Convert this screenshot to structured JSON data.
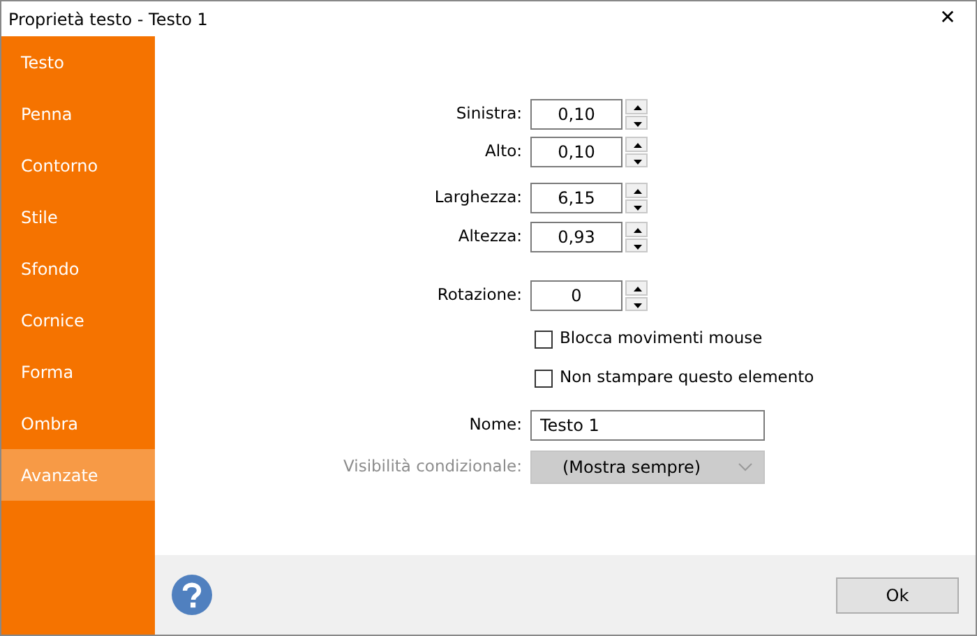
{
  "window": {
    "title": "Proprietà testo - Testo 1",
    "close": "✕"
  },
  "sidebar": {
    "items": [
      {
        "label": "Testo",
        "selected": false
      },
      {
        "label": "Penna",
        "selected": false
      },
      {
        "label": "Contorno",
        "selected": false
      },
      {
        "label": "Stile",
        "selected": false
      },
      {
        "label": "Sfondo",
        "selected": false
      },
      {
        "label": "Cornice",
        "selected": false
      },
      {
        "label": "Forma",
        "selected": false
      },
      {
        "label": "Ombra",
        "selected": false
      },
      {
        "label": "Avanzate",
        "selected": true
      }
    ]
  },
  "form": [
    {
      "kind": "spin",
      "label": "Sinistra:",
      "value": "0,10"
    },
    {
      "kind": "spin",
      "label": "Alto:",
      "value": "0,10"
    },
    {
      "kind": "spin",
      "label": "Larghezza:",
      "value": "6,15"
    },
    {
      "kind": "spin",
      "label": "Altezza:",
      "value": "0,93"
    },
    {
      "kind": "spin",
      "label": "Rotazione:",
      "value": "0"
    },
    {
      "kind": "checkbox",
      "label": "Blocca movimenti mouse",
      "checked": false
    },
    {
      "kind": "checkbox",
      "label": "Non stampare questo elemento",
      "checked": false
    },
    {
      "kind": "text",
      "label": "Nome:",
      "value": "Testo 1"
    },
    {
      "kind": "select",
      "label": "Visibilità condizionale:",
      "value": "(Mostra sempre)",
      "disabled": true
    }
  ],
  "buttons": [
    {
      "label": "Ok"
    }
  ]
}
